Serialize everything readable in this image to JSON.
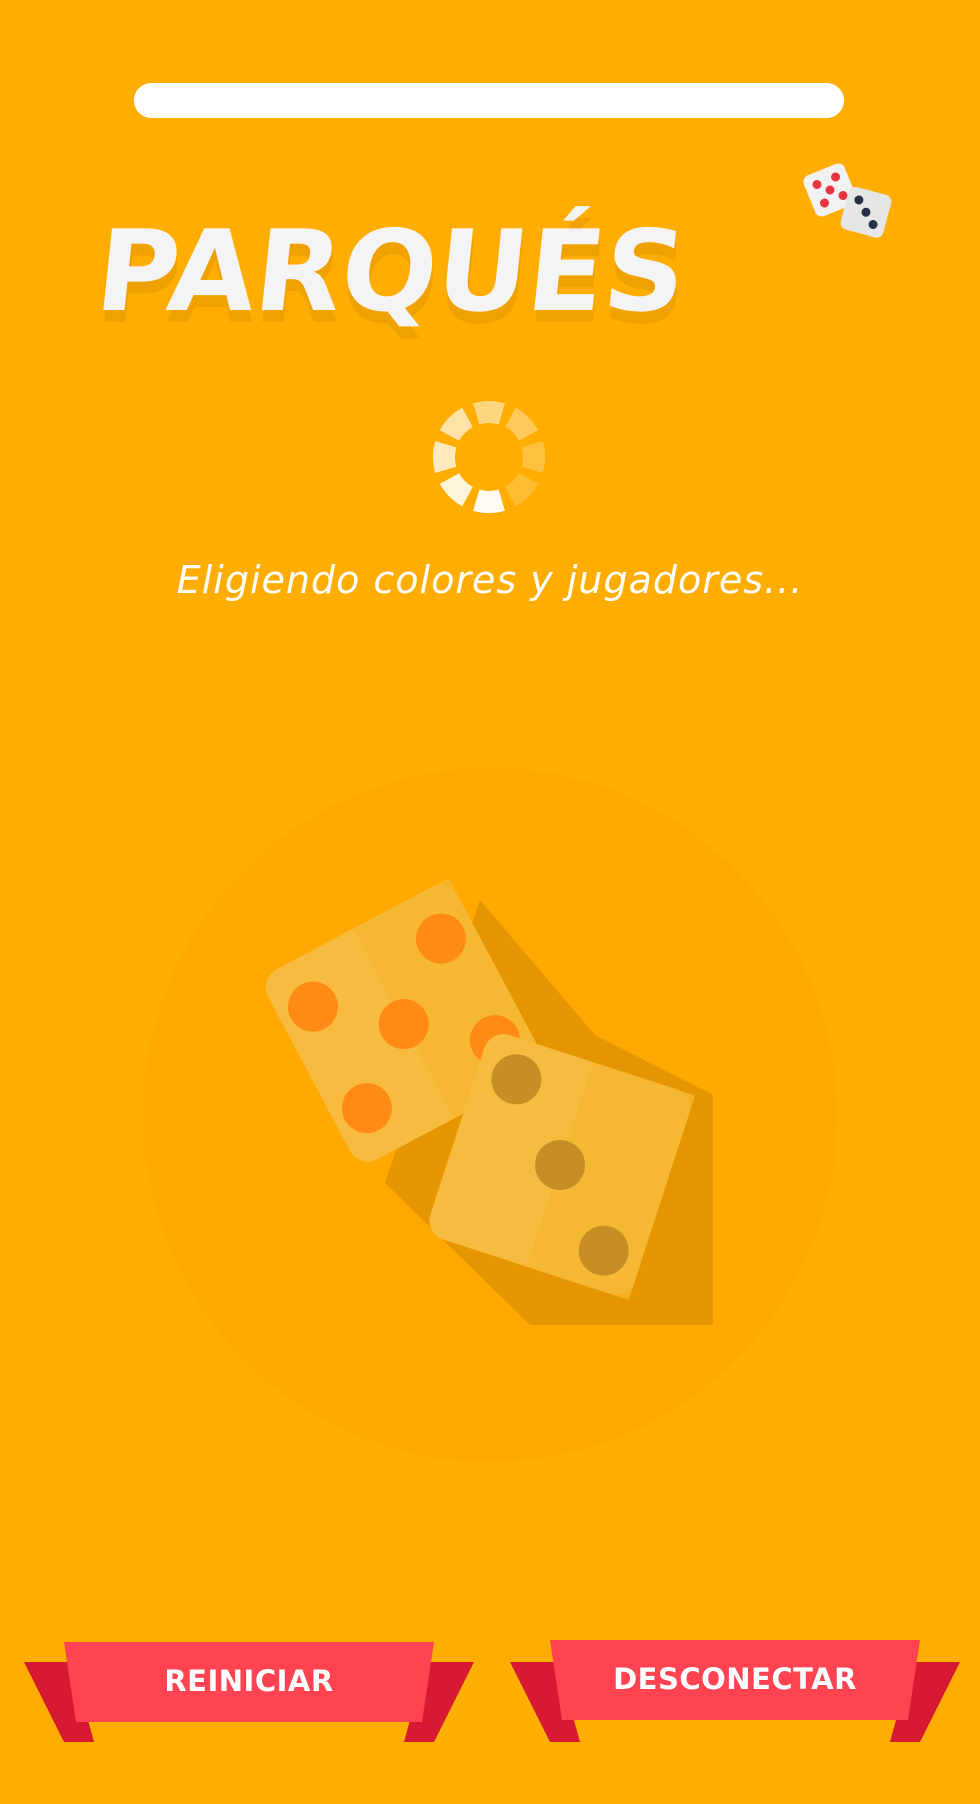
{
  "app": {
    "title": "PARQUÉS",
    "loading_text": "Eligiendo colores y jugadores...",
    "loading_progress": 1.0
  },
  "icons": {
    "logo_dice": "dice-icon",
    "spinner": "loading-spinner-icon",
    "illustration": "dice-illustration"
  },
  "buttons": {
    "restart_label": "REINICIAR",
    "disconnect_label": "DESCONECTAR"
  },
  "colors": {
    "background": "#FFAD00",
    "ribbon_front": "#FF4351",
    "ribbon_back": "#D61A33",
    "progress_track": "#F3F3F3"
  }
}
